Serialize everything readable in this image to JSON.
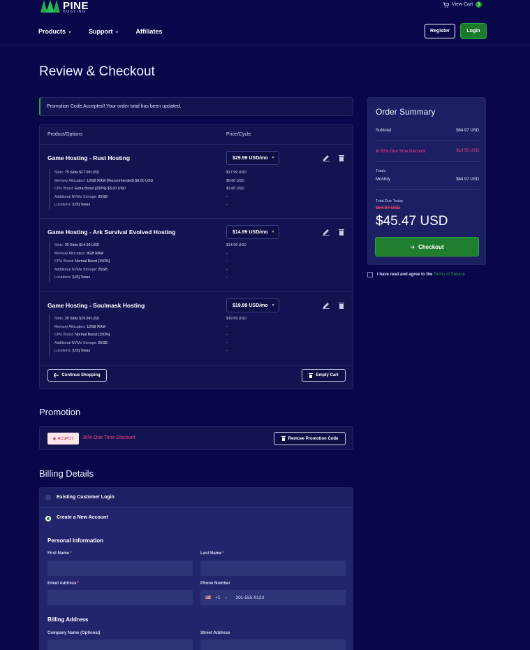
{
  "header": {
    "logo_main": "PINE",
    "logo_sub": "HOSTING",
    "view_cart": "View Cart",
    "cart_count": "3",
    "nav": [
      {
        "label": "Products",
        "dropdown": true
      },
      {
        "label": "Support",
        "dropdown": true
      },
      {
        "label": "Affiliates",
        "dropdown": false
      }
    ],
    "register": "Register",
    "login": "Login"
  },
  "page_title": "Review & Checkout",
  "alert": "Promotion Code Accepted! Your order total has been updated.",
  "cart": {
    "col_product": "Product/Options",
    "col_price": "Price/Cycle",
    "items": [
      {
        "title": "Game Hosting - Rust Hosting",
        "cycle": "$29.99 USD/mo",
        "options": [
          {
            "k": "Slots:",
            "v": "75 Slots $17.99 USD",
            "p": "$17.99 USD"
          },
          {
            "k": "Memory Allocation:",
            "v": "12GB RAM (Recommended) $9.00 USD",
            "p": "$9.00 USD"
          },
          {
            "k": "CPU Boost:",
            "v": "Extra Boost [200%] $3.00 USD",
            "p": "$3.00 USD"
          },
          {
            "k": "Additional NVMe Storage:",
            "v": "25GB",
            "p": "-"
          },
          {
            "k": "Locations:",
            "v": "[US] Texas",
            "p": "-"
          }
        ]
      },
      {
        "title": "Game Hosting - Ark Survival Evolved Hosting",
        "cycle": "$14.99 USD/mo",
        "options": [
          {
            "k": "Slots:",
            "v": "30 Slots $14.99 USD",
            "p": "$14.99 USD"
          },
          {
            "k": "Memory Allocation:",
            "v": "8GB RAM",
            "p": "-"
          },
          {
            "k": "CPU Boost:",
            "v": "Normal Boost [150%]",
            "p": "-"
          },
          {
            "k": "Additional NVMe Storage:",
            "v": "25GB",
            "p": "-"
          },
          {
            "k": "Locations:",
            "v": "[US] Texas",
            "p": "-"
          }
        ]
      },
      {
        "title": "Game Hosting - Soulmask Hosting",
        "cycle": "$19.99 USD/mo",
        "options": [
          {
            "k": "Slots:",
            "v": "20 Slots $19.99 USD",
            "p": "$19.99 USD"
          },
          {
            "k": "Memory Allocation:",
            "v": "12GB RAM",
            "p": "-"
          },
          {
            "k": "CPU Boost:",
            "v": "Normal Boost [150%]",
            "p": "-"
          },
          {
            "k": "Additional NVMe Storage:",
            "v": "25GB",
            "p": "-"
          },
          {
            "k": "Locations:",
            "v": "[US] Texas",
            "p": "-"
          }
        ]
      }
    ],
    "continue_shopping": "Continue Shopping",
    "empty_cart": "Empty Cart"
  },
  "promotion": {
    "title": "Promotion",
    "code": "HCSPOT",
    "description": "30% One Time Discount",
    "remove": "Remove Promotion Code"
  },
  "billing": {
    "title": "Billing Details",
    "existing_login": "Existing Customer Login",
    "create_account": "Create a New Account",
    "personal_info": "Personal Information",
    "first_name": "First Name",
    "last_name": "Last Name",
    "email": "Email Address",
    "phone": "Phone Number",
    "phone_code": "+1",
    "phone_placeholder": "201-555-0123",
    "billing_address": "Billing Address",
    "company": "Company Name (Optional)",
    "street": "Street Address"
  },
  "summary": {
    "title": "Order Summary",
    "subtotal_label": "Subtotal",
    "subtotal": "$64.97 USD",
    "discount_label": "30% One Time Discount",
    "discount": "$19.50 USD",
    "totals_label": "Totals",
    "monthly_label": "Monthly",
    "monthly": "$64.97 USD",
    "due_today_label": "Total Due Today",
    "old_total": "$64.97 USD",
    "total": "$45.47 USD",
    "checkout": "Checkout",
    "tos_text": "I have read and agree to the",
    "tos_link": "Terms of Service"
  },
  "colors": {
    "background": "#07074a",
    "accent_green": "#1f7f2e",
    "discount_pink": "#ff3d8a"
  }
}
